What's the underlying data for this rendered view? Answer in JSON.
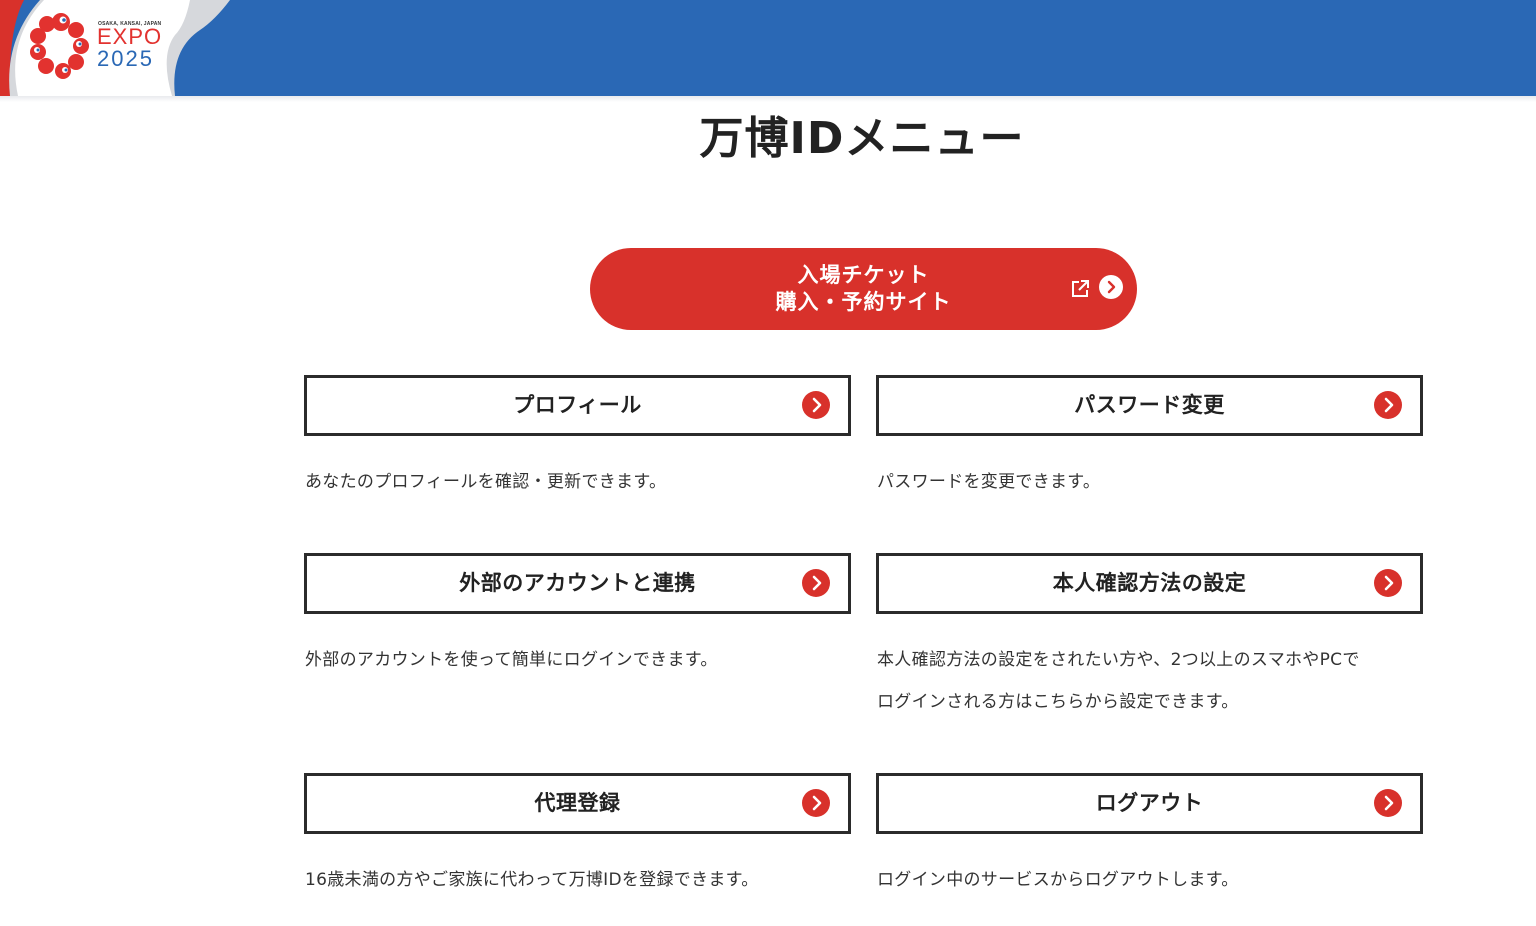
{
  "logo": {
    "small_text": "OSAKA, KANSAI, JAPAN",
    "expo": "EXPO",
    "year": "2025"
  },
  "page_title": "万博IDメニュー",
  "ticket": {
    "line1": "入場チケット",
    "line2": "購入・予約サイト"
  },
  "menu": {
    "profile": {
      "label": "プロフィール",
      "desc": "あなたのプロフィールを確認・更新できます。"
    },
    "password": {
      "label": "パスワード変更",
      "desc": "パスワードを変更できます。"
    },
    "external": {
      "label": "外部のアカウントと連携",
      "desc": "外部のアカウントを使って簡単にログインできます。"
    },
    "identity": {
      "label": "本人確認方法の設定",
      "desc_line1": "本人確認方法の設定をされたい方や、2つ以上のスマホやPCで",
      "desc_line2": "ログインされる方はこちらから設定できます。"
    },
    "proxy": {
      "label": "代理登録",
      "desc": "16歳未満の方やご家族に代わって万博IDを登録できます。"
    },
    "logout": {
      "label": "ログアウト",
      "desc": "ログイン中のサービスからログアウトします。"
    }
  },
  "colors": {
    "header_blue": "#2a68b5",
    "accent_red": "#d8312b",
    "border_dark": "#2b2b2b"
  }
}
